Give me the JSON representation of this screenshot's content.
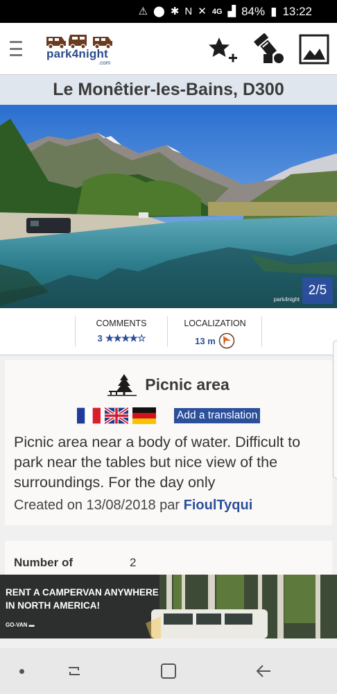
{
  "status_bar": {
    "battery": "84%",
    "time": "13:22",
    "network": "4G"
  },
  "app": {
    "logo_text": "park4night",
    "logo_sub": ".com"
  },
  "place": {
    "title": "Le Monêtier-les-Bains, D300"
  },
  "photo": {
    "counter": "2/5",
    "watermark": "park4night"
  },
  "stats": {
    "comments_label": "COMMENTS",
    "comments_count": "3",
    "rating": 4,
    "rating_max": 5,
    "localization_label": "LOCALIZATION",
    "distance": "13 m"
  },
  "detail": {
    "category": "Picnic area",
    "languages": [
      "fr",
      "en",
      "de"
    ],
    "translate_label": "Add a translation",
    "description": "Picnic area near a body of water. Difficult to park near the tables but nice view of the surroundings. For the day only",
    "created_prefix": "Created on 13/08/2018 par ",
    "author": "FioulTyqui"
  },
  "info": {
    "key": "Number of",
    "value": "2"
  },
  "ad": {
    "line1": "RENT A CAMPERVAN ANYWHERE",
    "line2": "IN NORTH AMERICA!",
    "brand": "GO-VAN"
  },
  "colors": {
    "brand_blue": "#2b4f9b",
    "title_bg": "#dfe6ed",
    "logo_brown": "#6a3b1f"
  }
}
